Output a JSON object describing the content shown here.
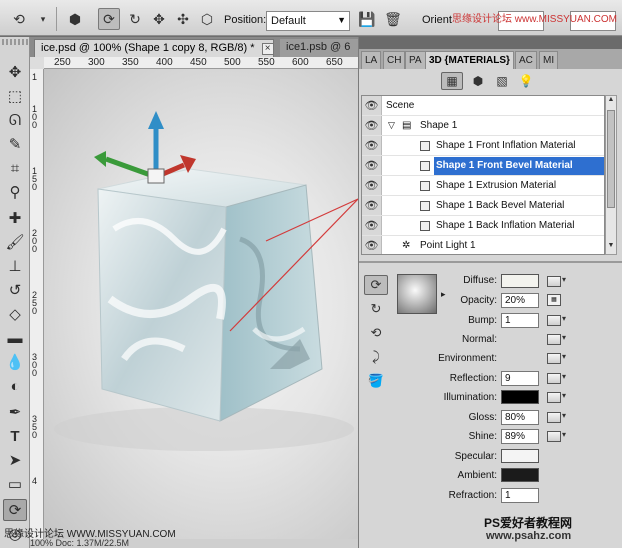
{
  "optionsbar": {
    "position_label": "Position:",
    "position_value": "Default",
    "orientation_label": "Orient"
  },
  "tabs": [
    {
      "label": "ice.psd @ 100% (Shape 1 copy 8, RGB/8) *",
      "active": true
    },
    {
      "label": "ice1.psb @ 6",
      "active": false
    }
  ],
  "ruler": {
    "h_ticks": [
      "250",
      "300",
      "350",
      "400",
      "450",
      "500",
      "550",
      "600",
      "650",
      "700"
    ],
    "v_ticks": [
      "1",
      "100",
      "150",
      "200",
      "250",
      "300",
      "350",
      "4"
    ]
  },
  "status_text": "100%   Doc: 1.37M/22.5M",
  "panel": {
    "tabs": [
      "LA",
      "CH",
      "PA",
      "3D {MATERIALS}",
      "AC",
      "MI"
    ],
    "scene": [
      {
        "label": "Scene",
        "kind": "scene"
      },
      {
        "label": "Shape 1",
        "kind": "group"
      },
      {
        "label": "Shape 1 Front Inflation Material",
        "kind": "material"
      },
      {
        "label": "Shape 1 Front Bevel Material",
        "kind": "material",
        "selected": true
      },
      {
        "label": "Shape 1 Extrusion Material",
        "kind": "material"
      },
      {
        "label": "Shape 1 Back Bevel Material",
        "kind": "material"
      },
      {
        "label": "Shape 1 Back Inflation Material",
        "kind": "material"
      },
      {
        "label": "Point Light 1",
        "kind": "light"
      }
    ],
    "properties": {
      "diffuse_label": "Diffuse:",
      "diffuse_color": "#f3f3ee",
      "opacity_label": "Opacity:",
      "opacity_value": "20%",
      "bump_label": "Bump:",
      "bump_value": "1",
      "normal_label": "Normal:",
      "environment_label": "Environment:",
      "reflection_label": "Reflection:",
      "reflection_value": "9",
      "illumination_label": "Illumination:",
      "illumination_color": "#000000",
      "gloss_label": "Gloss:",
      "gloss_value": "80%",
      "shine_label": "Shine:",
      "shine_value": "89%",
      "specular_label": "Specular:",
      "specular_color": "#f4f4f4",
      "ambient_label": "Ambient:",
      "ambient_color": "#1b1b1b",
      "refraction_label": "Refraction:",
      "refraction_value": "1"
    }
  },
  "watermark": {
    "cn": "PS爱好者教程网",
    "url": "www.psahz.com",
    "left": "思缘设计论坛 WWW.MISSYUAN.COM",
    "top": "思缘设计论坛 www.MISSYUAN.COM"
  },
  "colors": {
    "selection": "#2e6fd0",
    "gizmo_x": "#c0362c",
    "gizmo_y": "#2f8ec7",
    "gizmo_z": "#3a9a3a",
    "callout_line": "#d33b3b"
  }
}
